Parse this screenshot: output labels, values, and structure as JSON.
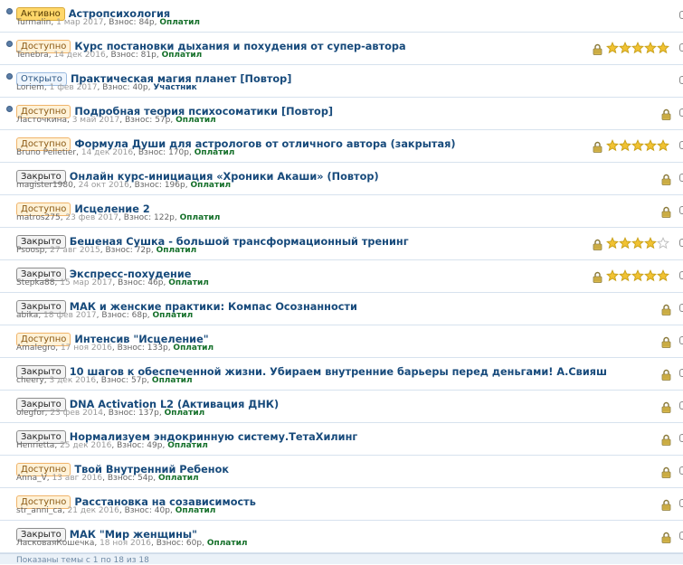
{
  "colors": {
    "title": "#174a7b",
    "paid": "#15702a",
    "border": "#d7e2ee",
    "star": "#f1c232"
  },
  "threads": [
    {
      "status": "Активно",
      "status_type": "active",
      "title": "Астропсихология",
      "author": "Turmalin",
      "date": "1 мар 2017",
      "fee_label": "Взнос:",
      "fee": "84р",
      "state": "Оплатил",
      "unread": true,
      "locked": false,
      "stars": null
    },
    {
      "status": "Доступно",
      "status_type": "available",
      "title": "Курс постановки дыхания и похудения от супер-автора",
      "author": "Tenebra",
      "date": "14 дек 2016",
      "fee_label": "Взнос:",
      "fee": "81р",
      "state": "Оплатил",
      "unread": true,
      "locked": true,
      "stars": 5
    },
    {
      "status": "Открыто",
      "status_type": "open",
      "title": "Практическая магия планет [Повтор]",
      "author": "Loriem",
      "date": "1 фев 2017",
      "fee_label": "Взнос:",
      "fee": "40р",
      "state": "Участник",
      "unread": true,
      "locked": false,
      "stars": null
    },
    {
      "status": "Доступно",
      "status_type": "available",
      "title": "Подробная теория психосоматики [Повтор]",
      "author": "Ласточкина",
      "date": "3 май 2017",
      "fee_label": "Взнос:",
      "fee": "57р",
      "state": "Оплатил",
      "unread": true,
      "locked": true,
      "stars": null
    },
    {
      "status": "Доступно",
      "status_type": "available",
      "title": "Формула Души для астрологов от отличного автора (закрытая)",
      "author": "Bruno Pelletier",
      "date": "14 дек 2016",
      "fee_label": "Взнос:",
      "fee": "170р",
      "state": "Оплатил",
      "unread": false,
      "locked": true,
      "stars": 5
    },
    {
      "status": "Закрыто",
      "status_type": "closed",
      "title": "Онлайн курс-инициация «Хроники Акаши» (Повтор)",
      "author": "magister1980",
      "date": "24 окт 2016",
      "fee_label": "Взнос:",
      "fee": "196р",
      "state": "Оплатил",
      "unread": false,
      "locked": true,
      "stars": null
    },
    {
      "status": "Доступно",
      "status_type": "available",
      "title": "Исцеление 2",
      "author": "matros275",
      "date": "23 фев 2017",
      "fee_label": "Взнос:",
      "fee": "122р",
      "state": "Оплатил",
      "unread": false,
      "locked": true,
      "stars": null
    },
    {
      "status": "Закрыто",
      "status_type": "closed",
      "title": "Бешеная Сушка - большой трансформационный тренинг",
      "author": "Psoosp",
      "date": "27 авг 2015",
      "fee_label": "Взнос:",
      "fee": "72р",
      "state": "Оплатил",
      "unread": false,
      "locked": true,
      "stars": 4
    },
    {
      "status": "Закрыто",
      "status_type": "closed",
      "title": "Экспресс-похудение",
      "author": "Stepka88",
      "date": "15 мар 2017",
      "fee_label": "Взнос:",
      "fee": "46р",
      "state": "Оплатил",
      "unread": false,
      "locked": true,
      "stars": 5
    },
    {
      "status": "Закрыто",
      "status_type": "closed",
      "title": "МАК и женские практики: Компас Осознанности",
      "author": "abika",
      "date": "18 фев 2017",
      "fee_label": "Взнос:",
      "fee": "68р",
      "state": "Оплатил",
      "unread": false,
      "locked": true,
      "stars": null
    },
    {
      "status": "Доступно",
      "status_type": "available",
      "title": "Интенсив \"Исцеление\"",
      "author": "Amalegro",
      "date": "17 ноя 2016",
      "fee_label": "Взнос:",
      "fee": "133р",
      "state": "Оплатил",
      "unread": false,
      "locked": true,
      "stars": null
    },
    {
      "status": "Закрыто",
      "status_type": "closed",
      "title": "10 шагов к обеспеченной жизни. Убираем внутренние барьеры перед деньгами! А.Свияш",
      "author": "cheery",
      "date": "3 дек 2016",
      "fee_label": "Взнос:",
      "fee": "57р",
      "state": "Оплатил",
      "unread": false,
      "locked": true,
      "stars": null
    },
    {
      "status": "Закрыто",
      "status_type": "closed",
      "title": "DNA Activation L2 (Активация ДНК)",
      "author": "olegfor",
      "date": "23 фев 2014",
      "fee_label": "Взнос:",
      "fee": "137р",
      "state": "Оплатил",
      "unread": false,
      "locked": true,
      "stars": null
    },
    {
      "status": "Закрыто",
      "status_type": "closed",
      "title": "Нормализуем эндокринную систему.ТетаХилинг",
      "author": "Henrietta",
      "date": "25 дек 2016",
      "fee_label": "Взнос:",
      "fee": "49р",
      "state": "Оплатил",
      "unread": false,
      "locked": true,
      "stars": null
    },
    {
      "status": "Доступно",
      "status_type": "available",
      "title": "Твой Внутренний Ребенок",
      "author": "Anna_V",
      "date": "13 авг 2016",
      "fee_label": "Взнос:",
      "fee": "54р",
      "state": "Оплатил",
      "unread": false,
      "locked": true,
      "stars": null
    },
    {
      "status": "Доступно",
      "status_type": "available",
      "title": "Расстановка на созависимость",
      "author": "str_anni_ca",
      "date": "21 дек 2016",
      "fee_label": "Взнос:",
      "fee": "40р",
      "state": "Оплатил",
      "unread": false,
      "locked": true,
      "stars": null
    },
    {
      "status": "Закрыто",
      "status_type": "closed",
      "title": "МАК \"Мир женщины\"",
      "author": "ЛасковаяКошечка",
      "date": "18 ноя 2016",
      "fee_label": "Взнос:",
      "fee": "60р",
      "state": "Оплатил",
      "unread": false,
      "locked": true,
      "stars": null
    }
  ],
  "footer": {
    "text": "Показаны темы с 1 по 18 из 18"
  }
}
